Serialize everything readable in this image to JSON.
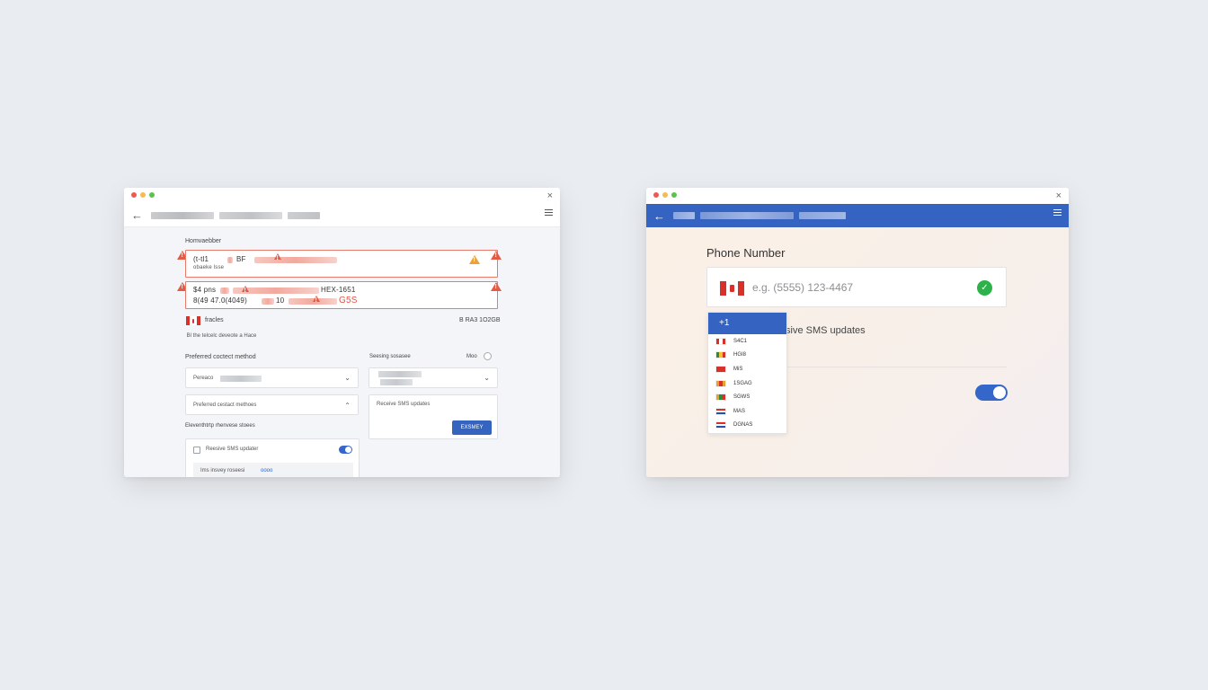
{
  "left_window": {
    "phone_label": "Homvaebber",
    "error1": {
      "line1_prefix": "(t-tl1 ",
      "line1_mid": "BF ",
      "line2": "obaeke lsse"
    },
    "error2": {
      "line1": "$4 pns ",
      "line1_tail": "HEX-1651",
      "line2_prefix": "8(49 47.0(4049) ",
      "line2_mid": "10 ",
      "line2_tail": "G5S"
    },
    "flag_label": "fracles",
    "flag_right": "B  RA3 1O2GB",
    "note": " Bl  the  telcelc  deveote  a   Hace",
    "contact_label": "Preferred coctect method",
    "sensing_label": "Seesing sosasee",
    "mo_label": "Moo",
    "select1_text": "Pereaco",
    "select2_text": "Preferred cestact methoes",
    "receive_card_text": "Receive SMS updates",
    "button_label": "EXSMEY",
    "section_label": "Eleventhtrtp rhenvese stoees",
    "checkbox_label": "Reesive SMS updater",
    "sub_text": "Ims    insvey  roseesi",
    "sub_link": "oooo"
  },
  "right_window": {
    "phone_label": "Phone Number",
    "phone_placeholder": "e.g. (5555) 123-4467",
    "sms_text": "sive SMS updates",
    "dropdown": {
      "selected": "+1",
      "items": [
        {
          "code": "S4C1",
          "flag": [
            "#d8312a",
            "#ffffff",
            "#d8312a"
          ]
        },
        {
          "code": "HGI8",
          "flag": [
            "#2e8b3a",
            "#f2c230",
            "#d8312a"
          ]
        },
        {
          "code": "MiS",
          "flag": [
            "#d8312a",
            "#d8312a",
            "#d8312a"
          ]
        },
        {
          "code": "1SGAG",
          "flag": [
            "#e8a030",
            "#d8312a",
            "#e8a030"
          ]
        },
        {
          "code": "SGWS",
          "flag": [
            "#e8a030",
            "#2e8b3a",
            "#d8312a"
          ]
        },
        {
          "code": "MAS",
          "flag": [
            "#d8312a",
            "#ffffff",
            "#2b4fa6"
          ]
        },
        {
          "code": "DGNAS",
          "flag": [
            "#d8312a",
            "#ffffff",
            "#2b4fa6"
          ]
        }
      ]
    }
  },
  "colors": {
    "accent_blue": "#3463c1",
    "error_red": "#e35a45",
    "success_green": "#2db24b",
    "background": "#e9ecf0"
  },
  "icons": [
    "back-arrow-icon",
    "hamburger-icon",
    "close-icon",
    "warning-icon",
    "chevron-down-icon",
    "chevron-up-icon",
    "check-circle-icon",
    "flag-canada-icon"
  ]
}
